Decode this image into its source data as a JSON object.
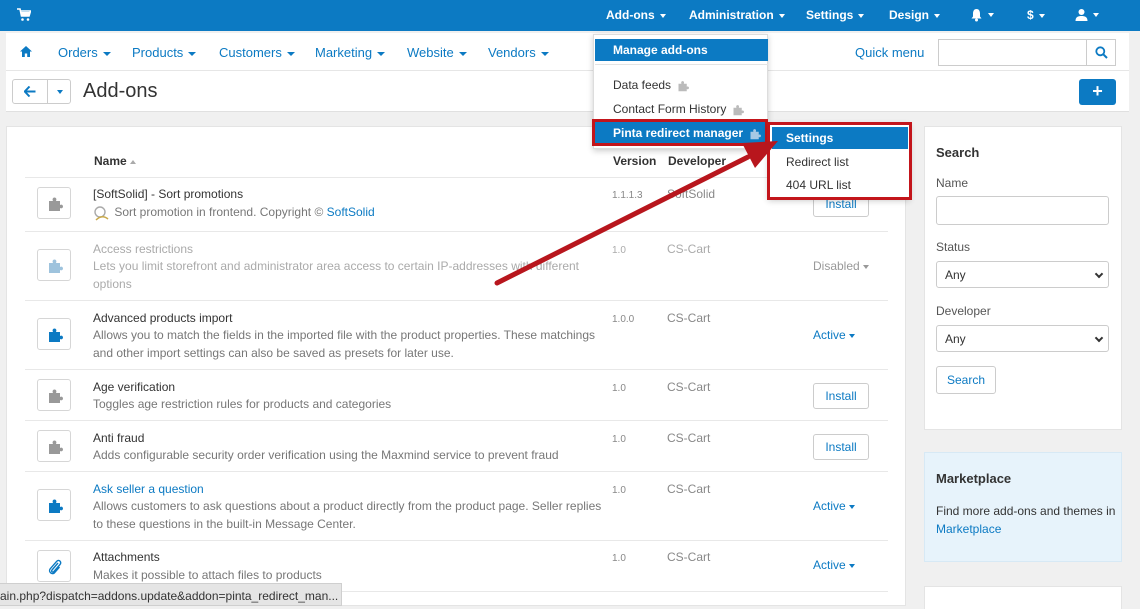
{
  "topbar": {
    "items": [
      "Add-ons",
      "Administration",
      "Settings",
      "Design"
    ],
    "currency": "$"
  },
  "nav": {
    "items": [
      "Orders",
      "Products",
      "Customers",
      "Marketing",
      "Website",
      "Vendors"
    ],
    "quick_menu": "Quick menu",
    "search_value": ""
  },
  "page": {
    "title": "Add-ons"
  },
  "table": {
    "headers": {
      "name": "Name",
      "version": "Version",
      "developer": "Developer"
    },
    "rows": [
      {
        "name": "[SoftSolid] - Sort promotions",
        "desc": "Sort promotion in frontend. Copyright ©",
        "desc_link": "SoftSolid",
        "version": "1.1.1.3",
        "developer": "SoftSolid",
        "action": "Install"
      },
      {
        "name": "Access restrictions",
        "desc": "Lets you limit storefront and administrator area access to certain IP-addresses with different options",
        "version": "1.0",
        "developer": "CS-Cart",
        "action": "Disabled"
      },
      {
        "name": "Advanced products import",
        "desc": "Allows you to match the fields in the imported file with the product properties. These matchings and other import settings can also be saved as presets for later use.",
        "version": "1.0.0",
        "developer": "CS-Cart",
        "action": "Active"
      },
      {
        "name": "Age verification",
        "desc": "Toggles age restriction rules for products and categories",
        "version": "1.0",
        "developer": "CS-Cart",
        "action": "Install"
      },
      {
        "name": "Anti fraud",
        "desc": "Adds configurable security order verification using the Maxmind service to prevent fraud",
        "version": "1.0",
        "developer": "CS-Cart",
        "action": "Install"
      },
      {
        "name": "Ask seller a question",
        "desc": "Allows customers to ask questions about a product directly from the product page. Seller replies to these questions in the built-in Message Center.",
        "version": "1.0",
        "developer": "CS-Cart",
        "action": "Active"
      },
      {
        "name": "Attachments",
        "desc": "Makes it possible to attach files to products",
        "version": "1.0",
        "developer": "CS-Cart",
        "action": "Active"
      }
    ]
  },
  "sidebar": {
    "search_title": "Search",
    "name_label": "Name",
    "status_label": "Status",
    "status_value": "Any",
    "developer_label": "Developer",
    "developer_value": "Any",
    "search_button": "Search",
    "market_title": "Marketplace",
    "market_text": "Find more add-ons and themes in",
    "market_link": "Marketplace"
  },
  "addons_menu": {
    "items": [
      "Manage add-ons",
      "Data feeds",
      "Contact Form History",
      "Pinta redirect manager"
    ]
  },
  "submenu": {
    "items": [
      "Settings",
      "Redirect list",
      "404 URL list"
    ]
  },
  "statusbar": {
    "url": "ain.php?dispatch=addons.update&addon=pinta_redirect_man..."
  },
  "colors": {
    "accent": "#0c7ac3",
    "highlight": "#c3151b"
  }
}
